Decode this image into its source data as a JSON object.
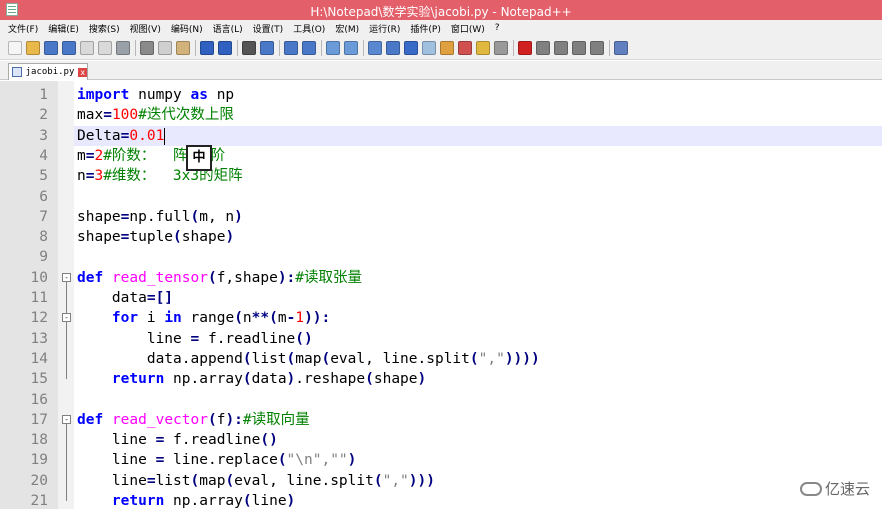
{
  "window": {
    "title": "H:\\Notepad\\数学实验\\jacobi.py - Notepad++"
  },
  "menu": [
    "文件(F)",
    "编辑(E)",
    "搜索(S)",
    "视图(V)",
    "编码(N)",
    "语言(L)",
    "设置(T)",
    "工具(O)",
    "宏(M)",
    "运行(R)",
    "插件(P)",
    "窗口(W)",
    "?"
  ],
  "toolbar": {
    "groups": [
      [
        {
          "icon": "new-file-icon",
          "color": "#f5f5f5"
        },
        {
          "icon": "open-folder-icon",
          "color": "#e8b84a"
        },
        {
          "icon": "save-icon",
          "color": "#4a78c8"
        },
        {
          "icon": "save-all-icon",
          "color": "#4a78c8"
        },
        {
          "icon": "close-file-icon",
          "color": "#d9d9d9"
        },
        {
          "icon": "close-all-icon",
          "color": "#d9d9d9"
        },
        {
          "icon": "print-icon",
          "color": "#9aa0a8"
        }
      ],
      [
        {
          "icon": "cut-icon",
          "color": "#8a8a8a"
        },
        {
          "icon": "copy-icon",
          "color": "#cfcfcf"
        },
        {
          "icon": "paste-icon",
          "color": "#d2b27a"
        }
      ],
      [
        {
          "icon": "undo-icon",
          "color": "#3060c0"
        },
        {
          "icon": "redo-icon",
          "color": "#3060c0"
        }
      ],
      [
        {
          "icon": "find-icon",
          "color": "#555555"
        },
        {
          "icon": "replace-icon",
          "color": "#4a78c8"
        }
      ],
      [
        {
          "icon": "zoom-in-icon",
          "color": "#4a78c8"
        },
        {
          "icon": "zoom-out-icon",
          "color": "#4a78c8"
        }
      ],
      [
        {
          "icon": "sync-vertical-icon",
          "color": "#6a9ad8"
        },
        {
          "icon": "sync-horizontal-icon",
          "color": "#6a9ad8"
        }
      ],
      [
        {
          "icon": "word-wrap-icon",
          "color": "#5a88d0"
        },
        {
          "icon": "show-all-chars-icon",
          "color": "#4a78c8"
        },
        {
          "icon": "indent-guide-icon",
          "color": "#3a6ac8"
        },
        {
          "icon": "lang-define-icon",
          "color": "#a0c0e0"
        },
        {
          "icon": "doc-map-icon",
          "color": "#e0a040"
        },
        {
          "icon": "function-list-icon",
          "color": "#d05050"
        },
        {
          "icon": "folder-workspace-icon",
          "color": "#e0b840"
        },
        {
          "icon": "monitoring-icon",
          "color": "#9a9a9a"
        }
      ],
      [
        {
          "icon": "record-macro-icon",
          "color": "#d02020"
        },
        {
          "icon": "stop-record-icon",
          "color": "#808080"
        },
        {
          "icon": "playback-icon",
          "color": "#808080"
        },
        {
          "icon": "run-multiple-icon",
          "color": "#808080"
        },
        {
          "icon": "save-macro-icon",
          "color": "#808080"
        }
      ],
      [
        {
          "icon": "spell-check-icon",
          "color": "#6080c0"
        }
      ]
    ]
  },
  "tab": {
    "label": "jacobi.py",
    "close_glyph": "x"
  },
  "ime_indicator": "中",
  "watermark": "亿速云",
  "editor": {
    "current_line": 3,
    "lines": [
      {
        "n": "1",
        "tokens": [
          {
            "t": "import",
            "c": "kw"
          },
          {
            "t": " numpy ",
            "c": "plain"
          },
          {
            "t": "as",
            "c": "kw"
          },
          {
            "t": " np",
            "c": "plain"
          }
        ]
      },
      {
        "n": "2",
        "tokens": [
          {
            "t": "max",
            "c": "plain"
          },
          {
            "t": "=",
            "c": "op"
          },
          {
            "t": "100",
            "c": "num"
          },
          {
            "t": "#迭代次数上限",
            "c": "com"
          }
        ]
      },
      {
        "n": "3",
        "tokens": [
          {
            "t": "Delta",
            "c": "plain"
          },
          {
            "t": "=",
            "c": "op"
          },
          {
            "t": "0.01",
            "c": "num"
          }
        ]
      },
      {
        "n": "4",
        "tokens": [
          {
            "t": "m",
            "c": "plain"
          },
          {
            "t": "=",
            "c": "op"
          },
          {
            "t": "2",
            "c": "num"
          },
          {
            "t": "#阶数：  阵为2阶",
            "c": "com"
          }
        ]
      },
      {
        "n": "5",
        "tokens": [
          {
            "t": "n",
            "c": "plain"
          },
          {
            "t": "=",
            "c": "op"
          },
          {
            "t": "3",
            "c": "num"
          },
          {
            "t": "#维数：  3x3的矩阵",
            "c": "com"
          }
        ]
      },
      {
        "n": "6",
        "tokens": []
      },
      {
        "n": "7",
        "tokens": [
          {
            "t": "shape",
            "c": "plain"
          },
          {
            "t": "=",
            "c": "op"
          },
          {
            "t": "np.full",
            "c": "plain"
          },
          {
            "t": "(",
            "c": "op"
          },
          {
            "t": "m, n",
            "c": "plain"
          },
          {
            "t": ")",
            "c": "op"
          }
        ]
      },
      {
        "n": "8",
        "tokens": [
          {
            "t": "shape",
            "c": "plain"
          },
          {
            "t": "=",
            "c": "op"
          },
          {
            "t": "tuple",
            "c": "plain"
          },
          {
            "t": "(",
            "c": "op"
          },
          {
            "t": "shape",
            "c": "plain"
          },
          {
            "t": ")",
            "c": "op"
          }
        ]
      },
      {
        "n": "9",
        "tokens": []
      },
      {
        "n": "10",
        "tokens": [
          {
            "t": "def",
            "c": "kw"
          },
          {
            "t": " ",
            "c": "plain"
          },
          {
            "t": "read_tensor",
            "c": "fn"
          },
          {
            "t": "(",
            "c": "op"
          },
          {
            "t": "f,shape",
            "c": "plain"
          },
          {
            "t": "):",
            "c": "op"
          },
          {
            "t": "#读取张量",
            "c": "com"
          }
        ]
      },
      {
        "n": "11",
        "tokens": [
          {
            "t": "    data",
            "c": "plain"
          },
          {
            "t": "=[]",
            "c": "op"
          }
        ]
      },
      {
        "n": "12",
        "tokens": [
          {
            "t": "    ",
            "c": "plain"
          },
          {
            "t": "for",
            "c": "kw"
          },
          {
            "t": " i ",
            "c": "plain"
          },
          {
            "t": "in",
            "c": "kw"
          },
          {
            "t": " range",
            "c": "plain"
          },
          {
            "t": "(",
            "c": "op"
          },
          {
            "t": "n",
            "c": "plain"
          },
          {
            "t": "**(",
            "c": "op"
          },
          {
            "t": "m",
            "c": "plain"
          },
          {
            "t": "-",
            "c": "op"
          },
          {
            "t": "1",
            "c": "num"
          },
          {
            "t": ")):",
            "c": "op"
          }
        ]
      },
      {
        "n": "13",
        "tokens": [
          {
            "t": "        line ",
            "c": "plain"
          },
          {
            "t": "=",
            "c": "op"
          },
          {
            "t": " f.readline",
            "c": "plain"
          },
          {
            "t": "()",
            "c": "op"
          }
        ]
      },
      {
        "n": "14",
        "tokens": [
          {
            "t": "        data.append",
            "c": "plain"
          },
          {
            "t": "(",
            "c": "op"
          },
          {
            "t": "list",
            "c": "plain"
          },
          {
            "t": "(",
            "c": "op"
          },
          {
            "t": "map",
            "c": "plain"
          },
          {
            "t": "(",
            "c": "op"
          },
          {
            "t": "eval, line.split",
            "c": "plain"
          },
          {
            "t": "(",
            "c": "op"
          },
          {
            "t": "\",\"",
            "c": "str"
          },
          {
            "t": "))))",
            "c": "op"
          }
        ]
      },
      {
        "n": "15",
        "tokens": [
          {
            "t": "    ",
            "c": "plain"
          },
          {
            "t": "return",
            "c": "kw"
          },
          {
            "t": " np.array",
            "c": "plain"
          },
          {
            "t": "(",
            "c": "op"
          },
          {
            "t": "data",
            "c": "plain"
          },
          {
            "t": ")",
            "c": "op"
          },
          {
            "t": ".reshape",
            "c": "plain"
          },
          {
            "t": "(",
            "c": "op"
          },
          {
            "t": "shape",
            "c": "plain"
          },
          {
            "t": ")",
            "c": "op"
          }
        ]
      },
      {
        "n": "16",
        "tokens": []
      },
      {
        "n": "17",
        "tokens": [
          {
            "t": "def",
            "c": "kw"
          },
          {
            "t": " ",
            "c": "plain"
          },
          {
            "t": "read_vector",
            "c": "fn"
          },
          {
            "t": "(",
            "c": "op"
          },
          {
            "t": "f",
            "c": "plain"
          },
          {
            "t": "):",
            "c": "op"
          },
          {
            "t": "#读取向量",
            "c": "com"
          }
        ]
      },
      {
        "n": "18",
        "tokens": [
          {
            "t": "    line ",
            "c": "plain"
          },
          {
            "t": "=",
            "c": "op"
          },
          {
            "t": " f.readline",
            "c": "plain"
          },
          {
            "t": "()",
            "c": "op"
          }
        ]
      },
      {
        "n": "19",
        "tokens": [
          {
            "t": "    line ",
            "c": "plain"
          },
          {
            "t": "=",
            "c": "op"
          },
          {
            "t": " line.replace",
            "c": "plain"
          },
          {
            "t": "(",
            "c": "op"
          },
          {
            "t": "\"\\n\",\"\"",
            "c": "str"
          },
          {
            "t": ")",
            "c": "op"
          }
        ]
      },
      {
        "n": "20",
        "tokens": [
          {
            "t": "    line",
            "c": "plain"
          },
          {
            "t": "=",
            "c": "op"
          },
          {
            "t": "list",
            "c": "plain"
          },
          {
            "t": "(",
            "c": "op"
          },
          {
            "t": "map",
            "c": "plain"
          },
          {
            "t": "(",
            "c": "op"
          },
          {
            "t": "eval, line.split",
            "c": "plain"
          },
          {
            "t": "(",
            "c": "op"
          },
          {
            "t": "\",\"",
            "c": "str"
          },
          {
            "t": ")))",
            "c": "op"
          }
        ]
      },
      {
        "n": "21",
        "tokens": [
          {
            "t": "    ",
            "c": "plain"
          },
          {
            "t": "return",
            "c": "kw"
          },
          {
            "t": " np.array",
            "c": "plain"
          },
          {
            "t": "(",
            "c": "op"
          },
          {
            "t": "line",
            "c": "plain"
          },
          {
            "t": ")",
            "c": "op"
          }
        ]
      }
    ]
  }
}
